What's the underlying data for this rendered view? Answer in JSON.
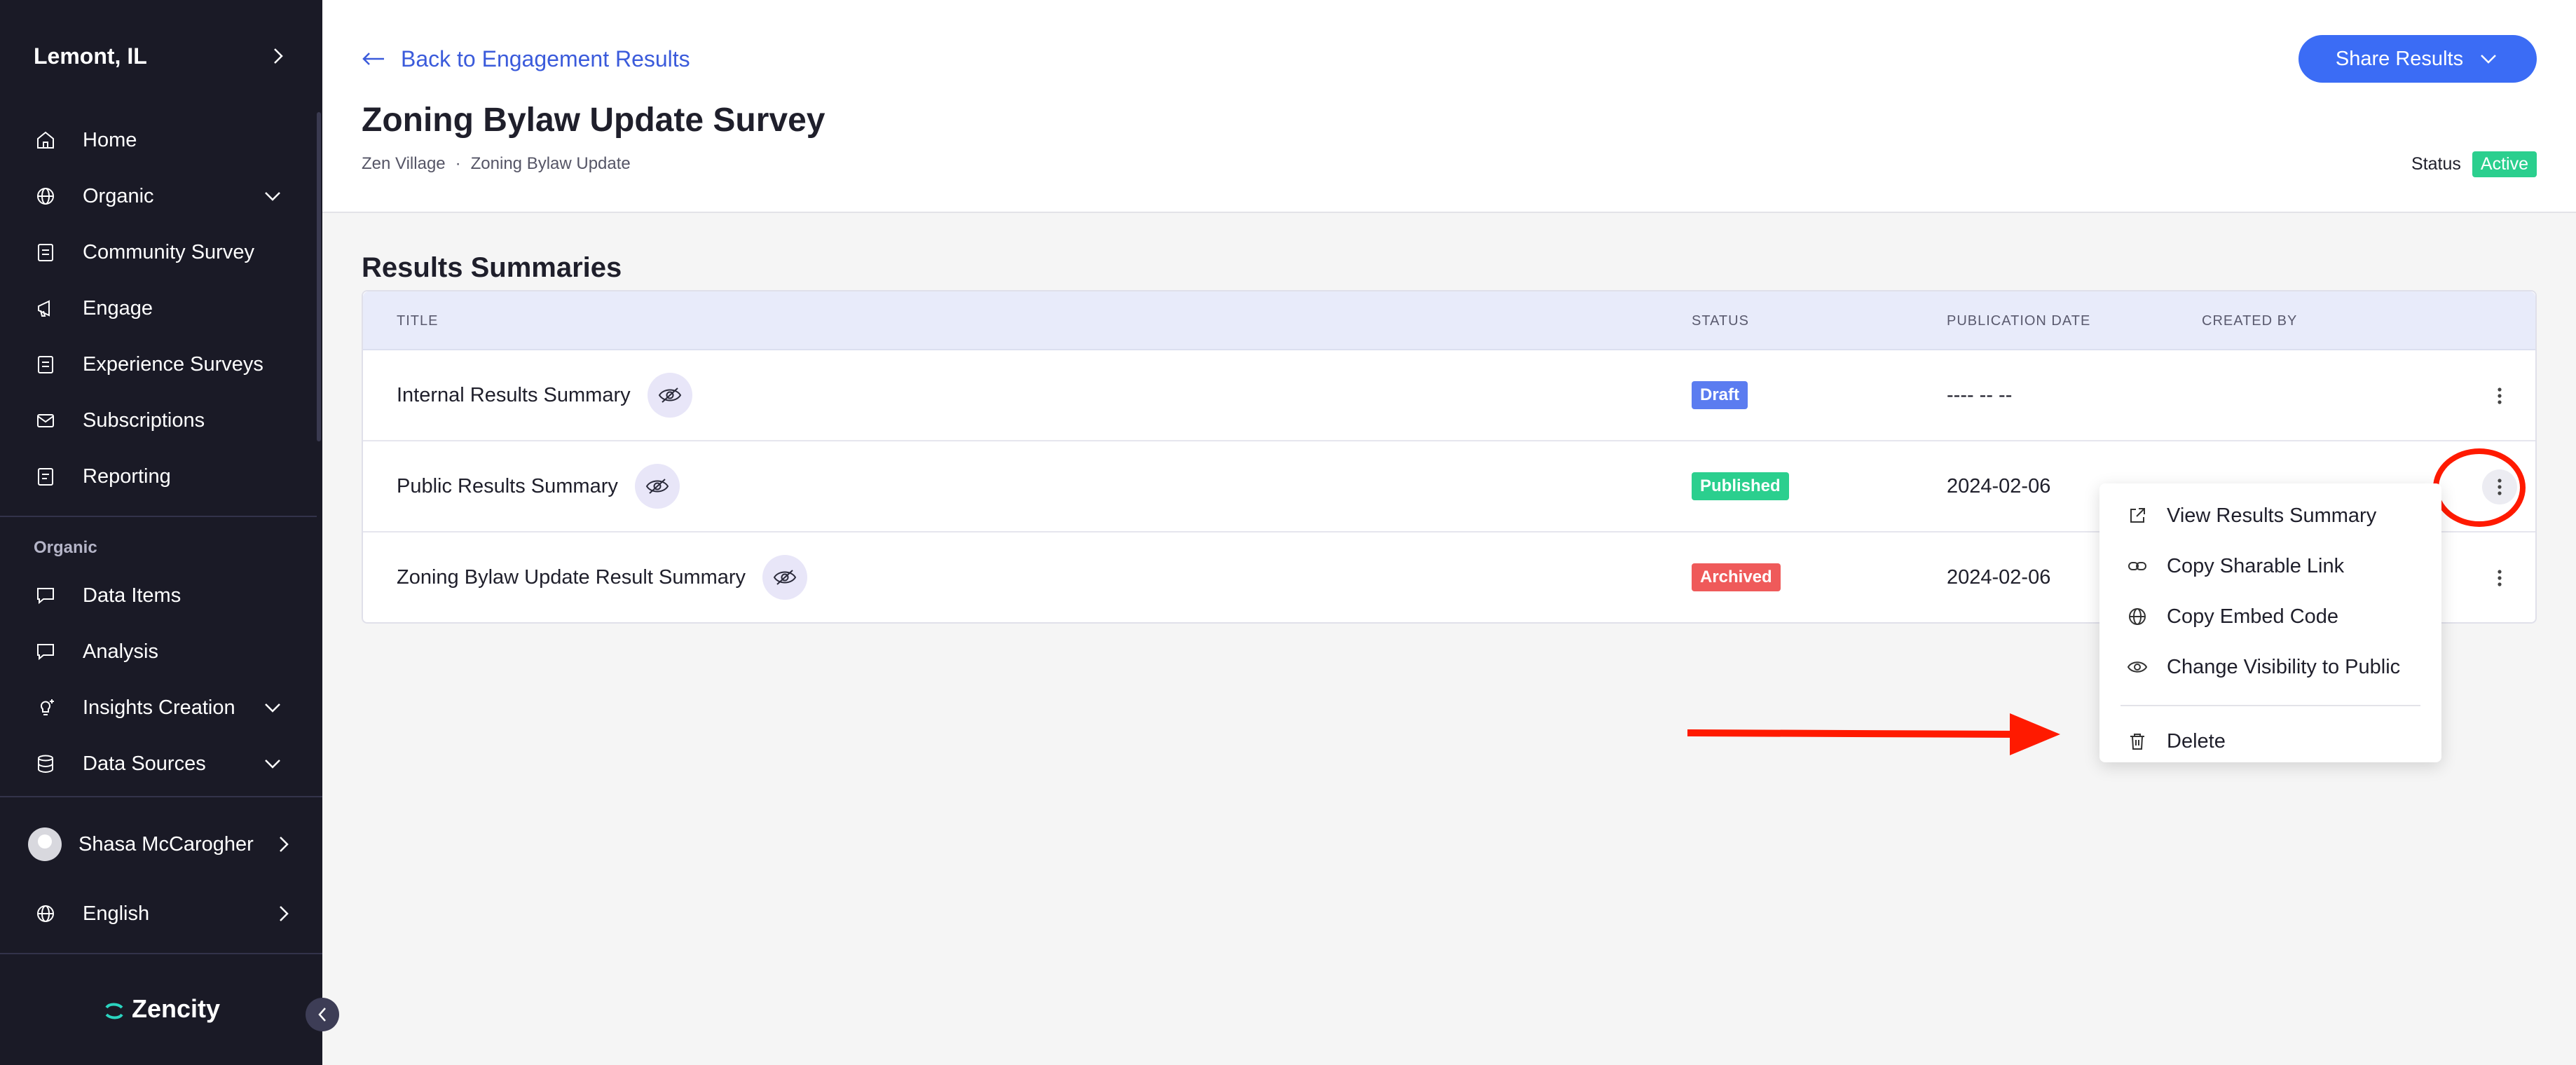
{
  "sidebar": {
    "city": "Lemont, IL",
    "items": [
      {
        "label": "Home",
        "icon": "home-icon"
      },
      {
        "label": "Organic",
        "icon": "globe-icon",
        "expandable": true
      },
      {
        "label": "Community Survey",
        "icon": "clipboard-icon"
      },
      {
        "label": "Engage",
        "icon": "engage-icon"
      },
      {
        "label": "Experience Surveys",
        "icon": "clipboard-icon"
      },
      {
        "label": "Subscriptions",
        "icon": "mail-icon"
      },
      {
        "label": "Reporting",
        "icon": "report-icon"
      }
    ],
    "section_label": "Organic",
    "section_items": [
      {
        "label": "Data Items",
        "icon": "chat-icon"
      },
      {
        "label": "Analysis",
        "icon": "chat-icon"
      },
      {
        "label": "Insights Creation",
        "icon": "lightbulb-icon",
        "expandable": true
      },
      {
        "label": "Data Sources",
        "icon": "database-icon",
        "expandable": true
      }
    ],
    "user_name": "Shasa McCarogher",
    "language": "English",
    "logo_text": "Zencity"
  },
  "header": {
    "back_label": "Back to Engagement Results",
    "title": "Zoning Bylaw Update Survey",
    "breadcrumb": [
      "Zen Village",
      "Zoning Bylaw Update"
    ],
    "breadcrumb_sep": "·",
    "share_label": "Share Results",
    "status_label": "Status",
    "status_value": "Active"
  },
  "main": {
    "section_title": "Results Summaries",
    "columns": {
      "title": "TITLE",
      "status": "STATUS",
      "publication_date": "PUBLICATION DATE",
      "created_by": "CREATED BY"
    },
    "rows": [
      {
        "title": "Internal Results Summary",
        "status": "Draft",
        "date": "---- -- --",
        "created_by": ""
      },
      {
        "title": "Public Results Summary",
        "status": "Published",
        "date": "2024-02-06",
        "created_by": ""
      },
      {
        "title": "Zoning Bylaw Update Result Summary",
        "status": "Archived",
        "date": "2024-02-06",
        "created_by": ""
      }
    ]
  },
  "menu": {
    "items": [
      {
        "label": "View Results Summary",
        "icon": "external-link-icon"
      },
      {
        "label": "Copy Sharable Link",
        "icon": "link-icon"
      },
      {
        "label": "Copy Embed Code",
        "icon": "globe-icon"
      },
      {
        "label": "Change Visibility to Public",
        "icon": "eye-icon"
      }
    ],
    "delete_label": "Delete"
  },
  "colors": {
    "sidebar_bg": "#1a1a26",
    "accent": "#3b6cf5",
    "active_green": "#2bcf8e",
    "draft_blue": "#5b7cf0",
    "archived_red": "#ef5a5a",
    "annotation_red": "#ff1a00"
  }
}
